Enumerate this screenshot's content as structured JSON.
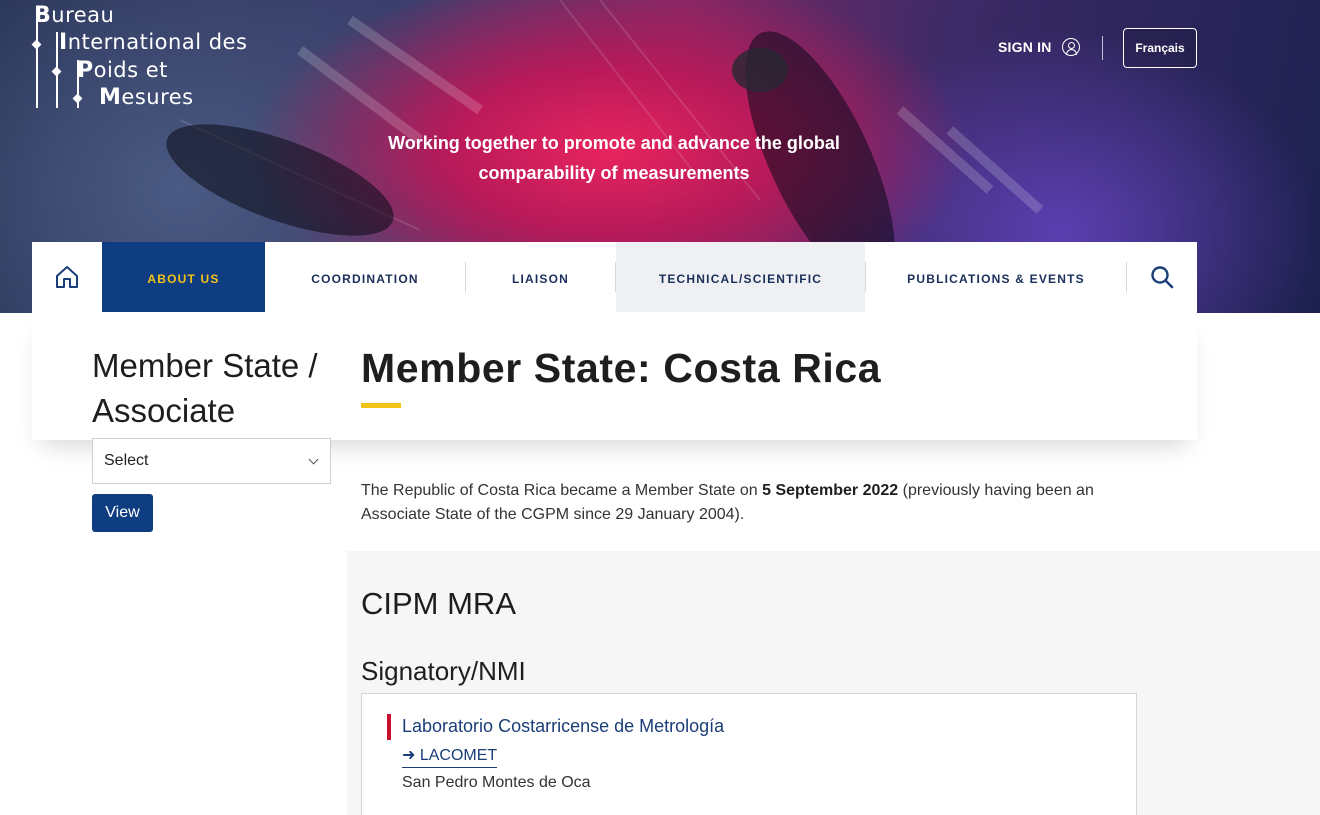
{
  "brand": {
    "logo_lines": [
      {
        "initial": "B",
        "rest": "ureau"
      },
      {
        "initial": "I",
        "rest": "nternational des"
      },
      {
        "initial": "P",
        "rest": "oids et"
      },
      {
        "initial": "M",
        "rest": "esures"
      }
    ],
    "tagline": "Working together to promote and advance the global comparability of measurements"
  },
  "header": {
    "sign_in_label": "SIGN IN",
    "language_label": "Français"
  },
  "nav": {
    "items": [
      {
        "label": "ABOUT US",
        "active": true
      },
      {
        "label": "COORDINATION"
      },
      {
        "label": "LIAISON"
      },
      {
        "label": "TECHNICAL/SCIENTIFIC"
      },
      {
        "label": "PUBLICATIONS & EVENTS"
      }
    ]
  },
  "sidebar": {
    "title": "Member State / Associate",
    "select_value": "Select",
    "view_label": "View"
  },
  "main": {
    "title": "Member State: Costa Rica",
    "intro_before": "The Republic of Costa Rica became a Member State on ",
    "intro_date": "5 September 2022",
    "intro_after": " (previously having been an Associate State of the CGPM since 29 January 2004).",
    "section_title": "CIPM MRA",
    "subsection_title": "Signatory/NMI",
    "signatory": {
      "name": "Laboratorio Costarricense de Metrología",
      "link_label": "➜ LACOMET",
      "location": "San Pedro Montes de Oca"
    }
  },
  "colors": {
    "navy": "#0f3d82",
    "gold": "#f2c317",
    "accent_red": "#c8102e",
    "link_blue": "#1a3e78"
  }
}
